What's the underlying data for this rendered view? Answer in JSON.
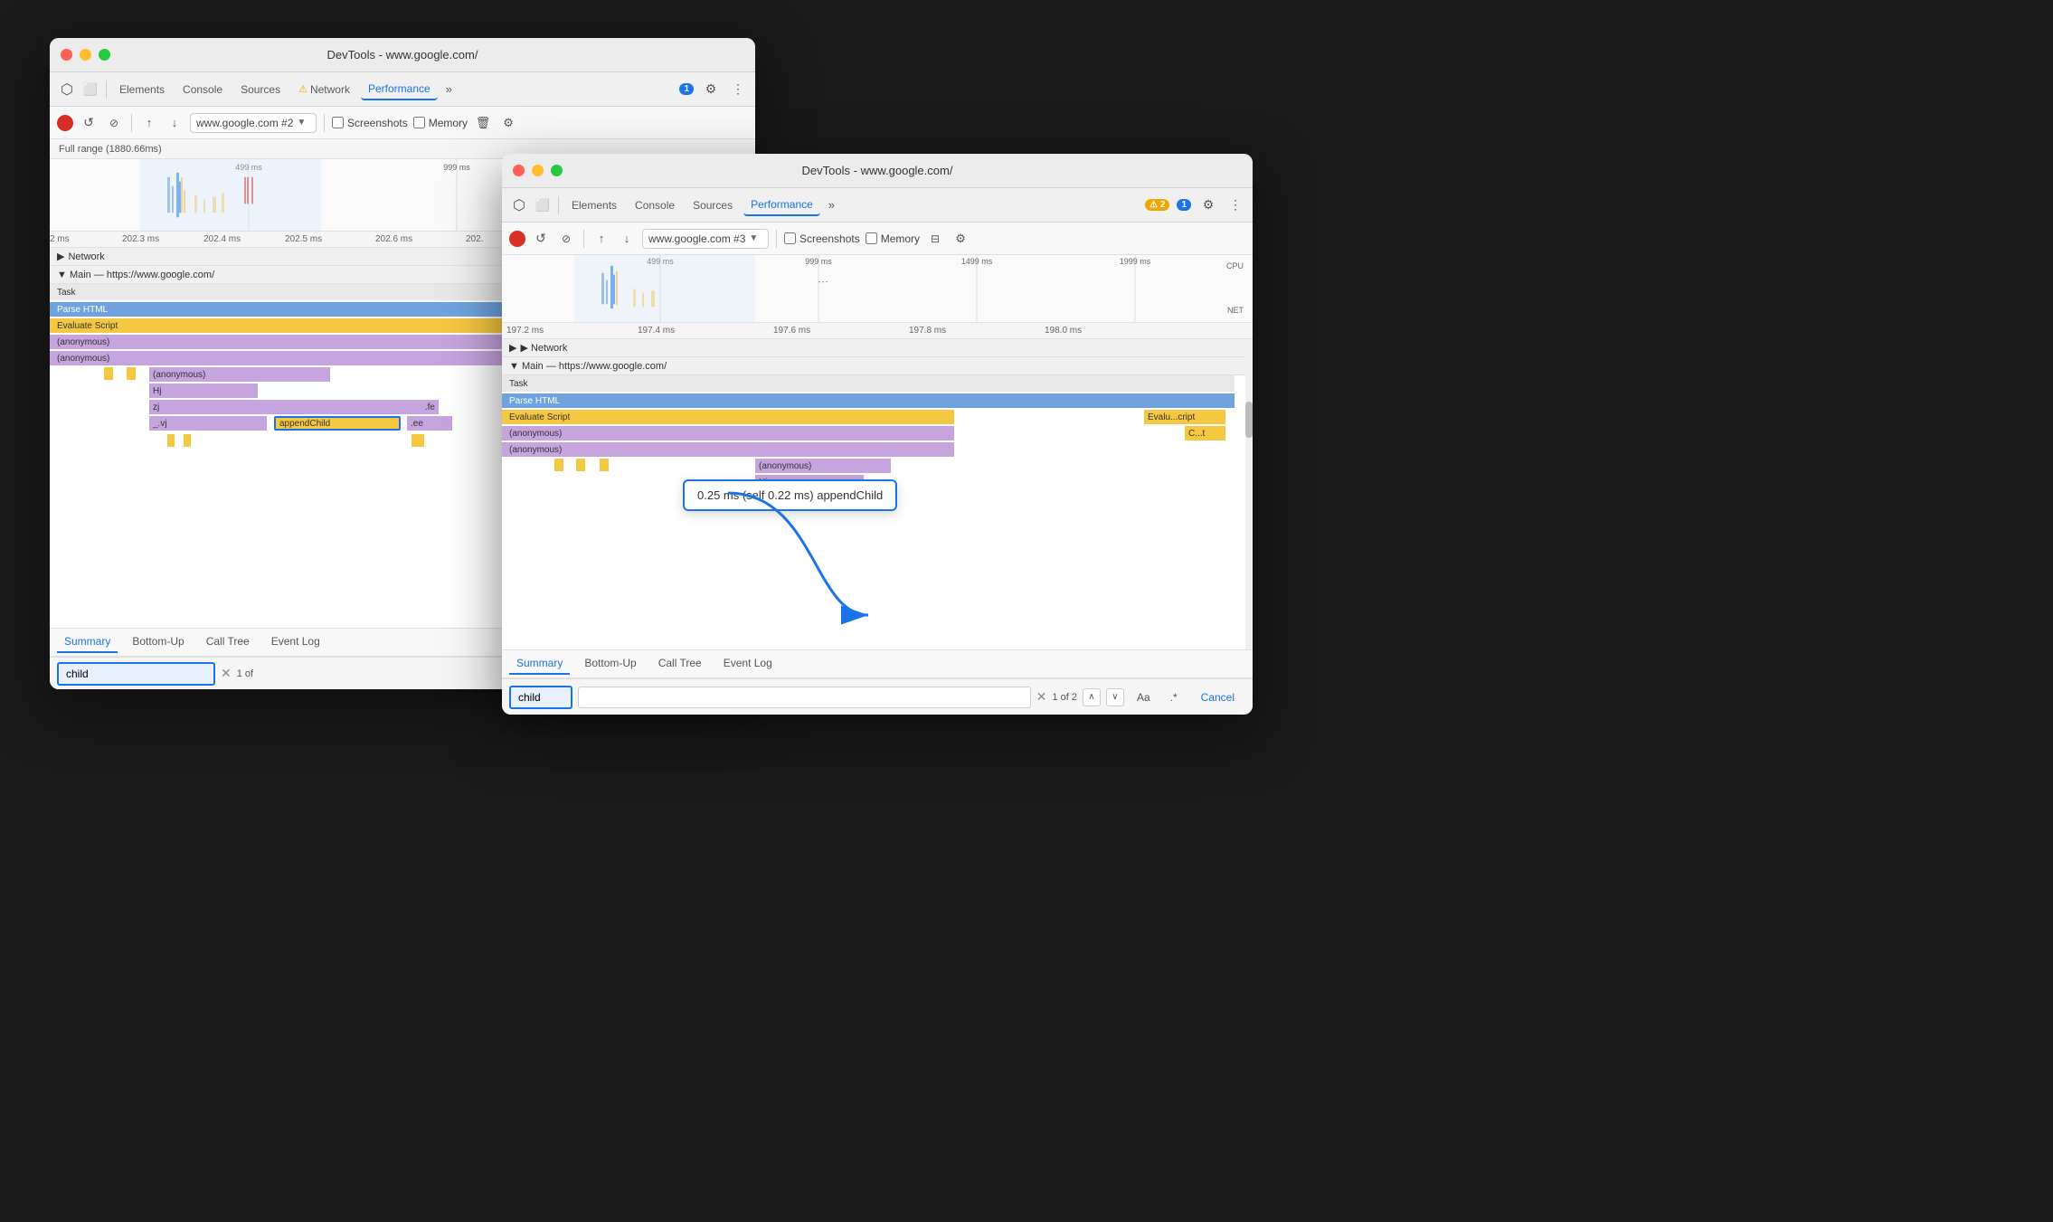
{
  "app": {
    "background": "#1a1a1a"
  },
  "window1": {
    "title": "DevTools - www.google.com/",
    "tabs": [
      {
        "label": "Elements",
        "active": false
      },
      {
        "label": "Console",
        "active": false
      },
      {
        "label": "Sources",
        "active": false
      },
      {
        "label": "Network",
        "active": false,
        "warning": true
      },
      {
        "label": "Performance",
        "active": true
      }
    ],
    "more_tabs": "»",
    "badge_label": "1",
    "settings_icon": "⚙",
    "more_icon": "⋮",
    "record_btn": "●",
    "reload_btn": "↺",
    "clear_btn": "🚫",
    "upload_btn": "↑",
    "download_btn": "↓",
    "url": "www.google.com #2",
    "screenshots_label": "Screenshots",
    "memory_label": "Memory",
    "trash_icon": "🗑",
    "settings2_icon": "⚙",
    "full_range": "Full range (1880.66ms)",
    "timeline_marks": [
      "499 ms",
      "999 ms"
    ],
    "ruler_marks": [
      "2 ms",
      "202.3 ms",
      "202.4 ms",
      "202.5 ms",
      "202.6 ms",
      "202."
    ],
    "network_label": "Network",
    "main_label": "▼ Main — https://www.google.com/",
    "task_label": "Task",
    "parse_html_label": "Parse HTML",
    "evaluate_script_label": "Evaluate Script",
    "anonymous1_label": "(anonymous)",
    "anonymous2_label": "(anonymous)",
    "anonymous3_label": "(anonymous)",
    "hj_label": "Hj",
    "zj_label": "zj",
    "fe_label": ".fe",
    "vj_label": "_.vj",
    "append_child_label": "appendChild",
    "ee_label": ".ee",
    "bottom_tabs": [
      "Summary",
      "Bottom-Up",
      "Call Tree",
      "Event Log"
    ],
    "active_bottom_tab": "Summary",
    "search_value": "child",
    "search_count": "1 of",
    "clear_search_icon": "✕"
  },
  "window2": {
    "title": "DevTools - www.google.com/",
    "tabs": [
      {
        "label": "Elements",
        "active": false
      },
      {
        "label": "Console",
        "active": false
      },
      {
        "label": "Sources",
        "active": false
      },
      {
        "label": "Performance",
        "active": true
      }
    ],
    "more_tabs": "»",
    "warning_badge": "2",
    "badge_label": "1",
    "settings_icon": "⚙",
    "more_icon": "⋮",
    "record_btn": "●",
    "reload_btn": "↺",
    "clear_btn": "🚫",
    "upload_btn": "↑",
    "download_btn": "↓",
    "url": "www.google.com #3",
    "screenshots_label": "Screenshots",
    "memory_label": "Memory",
    "cpu_label": "CPU",
    "net_label": "NET",
    "settings2_icon": "⚙",
    "timeline_marks": [
      "499 ms",
      "999 ms",
      "1499 ms",
      "1999 ms"
    ],
    "ruler_marks": [
      "197.2 ms",
      "197.4 ms",
      "197.6 ms",
      "197.8 ms",
      "198.0 ms"
    ],
    "network_label": "▶ Network",
    "main_label": "▼ Main — https://www.google.com/",
    "task_label": "Task",
    "parse_html_label": "Parse HTML",
    "evaluate_script_label": "Evaluate Script",
    "evalu_cript_label": "Evalu...cript",
    "ct_label": "C...t",
    "anonymous1_label": "(anonymous)",
    "anonymous2_label": "(anonymous)",
    "anonymous3_label": "(anonymous)",
    "hj_label": "Hj",
    "append_child_tooltip": "0.25 ms (self 0.22 ms)  appendChild",
    "bottom_tabs": [
      "Summary",
      "Bottom-Up",
      "Call Tree",
      "Event Log"
    ],
    "active_bottom_tab": "Summary",
    "search_value": "child",
    "search_count": "1 of 2",
    "clear_search_icon": "✕",
    "aa_label": "Aa",
    "dot_label": ".*",
    "cancel_label": "Cancel"
  }
}
